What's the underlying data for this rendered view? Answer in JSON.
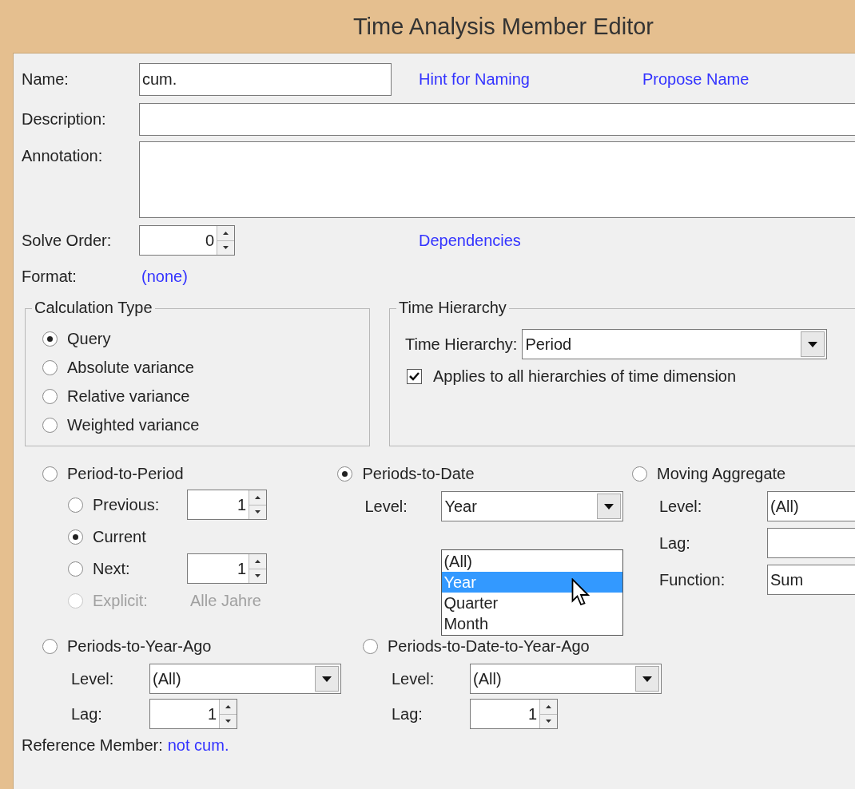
{
  "window": {
    "title": "Time Analysis Member Editor"
  },
  "fields": {
    "name": {
      "label": "Name:",
      "value": "cum."
    },
    "hint_link": "Hint for Naming",
    "propose_link": "Propose Name",
    "description": {
      "label": "Description:"
    },
    "annotation": {
      "label": "Annotation:"
    },
    "solve_order": {
      "label": "Solve Order:",
      "value": "0"
    },
    "dependencies_link": "Dependencies",
    "format": {
      "label": "Format:",
      "value": "(none)"
    }
  },
  "calculation_type": {
    "title": "Calculation Type",
    "options": [
      {
        "label": "Query",
        "selected": true
      },
      {
        "label": "Absolute variance",
        "selected": false
      },
      {
        "label": "Relative variance",
        "selected": false
      },
      {
        "label": "Weighted variance",
        "selected": false
      }
    ]
  },
  "time_hierarchy": {
    "title": "Time Hierarchy",
    "label": "Time Hierarchy:",
    "value": "Period",
    "applies_all": {
      "label": "Applies to all hierarchies of time dimension",
      "checked": true
    }
  },
  "period_to_period": {
    "label": "Period-to-Period",
    "selected": false,
    "options": [
      {
        "kind": "spin",
        "label": "Previous:",
        "value": "1",
        "selected": false,
        "disabled": false
      },
      {
        "kind": "plain",
        "label": "Current",
        "selected": true,
        "disabled": false
      },
      {
        "kind": "spin",
        "label": "Next:",
        "value": "1",
        "selected": false,
        "disabled": false
      },
      {
        "kind": "text",
        "label": "Explicit:",
        "value": "Alle Jahre",
        "selected": false,
        "disabled": true
      }
    ]
  },
  "periods_to_date": {
    "label": "Periods-to-Date",
    "selected": true,
    "level_label": "Level:",
    "level": "Year",
    "dropdown": [
      {
        "label": "(All)",
        "selected": false
      },
      {
        "label": "Year",
        "selected": true
      },
      {
        "label": "Quarter",
        "selected": false
      },
      {
        "label": "Month",
        "selected": false
      }
    ]
  },
  "moving_aggregate": {
    "label": "Moving Aggregate",
    "selected": false,
    "level_label": "Level:",
    "level": "(All)",
    "lag_label": "Lag:",
    "function_label": "Function:",
    "function": "Sum"
  },
  "periods_to_year_ago": {
    "label": "Periods-to-Year-Ago",
    "selected": false,
    "level_label": "Level:",
    "level": "(All)",
    "lag_label": "Lag:",
    "lag": "1"
  },
  "periods_to_date_to_year_ago": {
    "label": "Periods-to-Date-to-Year-Ago",
    "selected": false,
    "level_label": "Level:",
    "level": "(All)",
    "lag_label": "Lag:",
    "lag": "1"
  },
  "reference_member": {
    "label": "Reference Member:",
    "value": "not cum."
  }
}
